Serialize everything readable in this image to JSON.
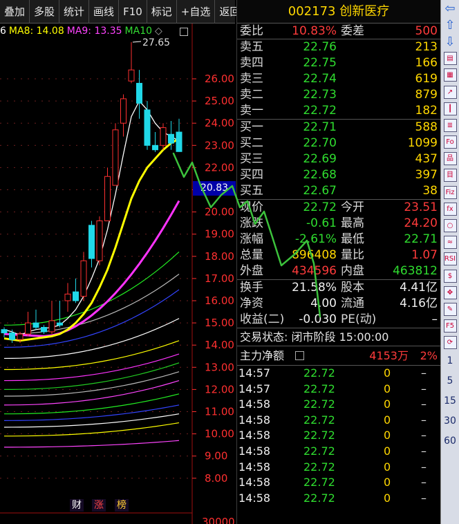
{
  "toolbar": {
    "buttons": [
      "叠加",
      "多股",
      "统计",
      "画线",
      "F10",
      "标记",
      "+自选",
      "返回"
    ]
  },
  "ma_legend": [
    {
      "label": "6",
      "color": "#ffffff"
    },
    {
      "label": "MA8: 14.08",
      "color": "#ffff00"
    },
    {
      "label": "MA9: 13.35",
      "color": "#ff44ff"
    },
    {
      "label": "MA10",
      "color": "#33dd33"
    }
  ],
  "legend_toggle_icon": "◇",
  "chart": {
    "price_labels": [
      "26.00",
      "25.00",
      "24.00",
      "23.00",
      "22.00",
      "21.00",
      "20.00",
      "19.00",
      "18.00",
      "17.00",
      "16.00",
      "15.00",
      "14.00",
      "13.00",
      "12.00",
      "11.00",
      "10.00",
      "9.00",
      "8.00"
    ],
    "price_values": [
      26,
      25,
      24,
      23,
      22,
      21,
      20,
      19,
      18,
      17,
      16,
      15,
      14,
      13,
      12,
      11,
      10,
      9,
      8
    ],
    "high_marker": "27.65",
    "current_price": "20.83",
    "bottom_axis_value": "30000",
    "badges": [
      "财",
      "涨",
      "榜"
    ],
    "candles": [
      {
        "o": 14.7,
        "c": 14.55,
        "h": 14.8,
        "l": 14.35
      },
      {
        "o": 14.55,
        "c": 14.25,
        "h": 14.7,
        "l": 14.1
      },
      {
        "o": 14.25,
        "c": 14.5,
        "h": 14.6,
        "l": 14.1
      },
      {
        "o": 14.5,
        "c": 15.0,
        "h": 15.5,
        "l": 14.4
      },
      {
        "o": 15.0,
        "c": 14.8,
        "h": 15.6,
        "l": 14.7
      },
      {
        "o": 14.8,
        "c": 14.6,
        "h": 14.9,
        "l": 14.5
      },
      {
        "o": 14.6,
        "c": 15.1,
        "h": 16.0,
        "l": 14.5
      },
      {
        "o": 15.0,
        "c": 14.9,
        "h": 16.0,
        "l": 14.8
      },
      {
        "o": 16.0,
        "c": 16.3,
        "h": 16.8,
        "l": 15.5
      },
      {
        "o": 16.4,
        "c": 16.0,
        "h": 17.0,
        "l": 15.9
      },
      {
        "o": 16.2,
        "c": 17.8,
        "h": 18.2,
        "l": 16.0
      },
      {
        "o": 19.4,
        "c": 17.9,
        "h": 19.6,
        "l": 17.5
      },
      {
        "o": 17.8,
        "c": 19.6,
        "h": 19.8,
        "l": 17.6
      },
      {
        "o": 19.6,
        "c": 21.6,
        "h": 22.0,
        "l": 19.6
      },
      {
        "o": 21.2,
        "c": 23.7,
        "h": 24.0,
        "l": 21.2
      },
      {
        "o": 24.0,
        "c": 25.1,
        "h": 25.3,
        "l": 23.4
      },
      {
        "o": 25.9,
        "c": 26.4,
        "h": 27.65,
        "l": 25.8
      },
      {
        "o": 25.8,
        "c": 24.9,
        "h": 26.4,
        "l": 24.2
      },
      {
        "o": 24.6,
        "c": 23.0,
        "h": 25.0,
        "l": 22.8
      },
      {
        "o": 23.0,
        "c": 22.8,
        "h": 23.6,
        "l": 22.7
      },
      {
        "o": 23.0,
        "c": 23.8,
        "h": 24.0,
        "l": 22.8
      },
      {
        "o": 23.5,
        "c": 23.1,
        "h": 24.1,
        "l": 22.8
      },
      {
        "o": 23.6,
        "c": 22.72,
        "h": 24.2,
        "l": 22.71
      }
    ],
    "ma_lines": [
      {
        "color": "#ffffff",
        "values": [
          14.7,
          14.6,
          14.45,
          14.6,
          14.7,
          14.75,
          14.8,
          14.9,
          15.2,
          15.6,
          16.2,
          17.0,
          17.9,
          19.2,
          20.8,
          22.6,
          24.3,
          25.0,
          24.6,
          24.0,
          23.6,
          23.4,
          23.2
        ]
      },
      {
        "color": "#ffff00",
        "values": [
          14.3,
          14.25,
          14.2,
          14.25,
          14.3,
          14.35,
          14.4,
          14.5,
          14.7,
          15.0,
          15.4,
          15.9,
          16.6,
          17.4,
          18.4,
          19.5,
          20.6,
          21.4,
          22.0,
          22.4,
          22.8,
          23.1,
          23.3
        ]
      }
    ]
  },
  "quote": {
    "title": "002173 创新医疗",
    "committee_ratio": {
      "label": "委比",
      "value": "10.83%",
      "diff_label": "委差",
      "diff_value": "500"
    },
    "asks": [
      {
        "label": "卖五",
        "price": "22.76",
        "vol": "213"
      },
      {
        "label": "卖四",
        "price": "22.75",
        "vol": "166"
      },
      {
        "label": "卖三",
        "price": "22.74",
        "vol": "619"
      },
      {
        "label": "卖二",
        "price": "22.73",
        "vol": "879"
      },
      {
        "label": "卖一",
        "price": "22.72",
        "vol": "182"
      }
    ],
    "bids": [
      {
        "label": "买一",
        "price": "22.71",
        "vol": "588"
      },
      {
        "label": "买二",
        "price": "22.70",
        "vol": "1099"
      },
      {
        "label": "买三",
        "price": "22.69",
        "vol": "437"
      },
      {
        "label": "买四",
        "price": "22.68",
        "vol": "397"
      },
      {
        "label": "买五",
        "price": "22.67",
        "vol": "38"
      }
    ],
    "stats": [
      {
        "l1": "现价",
        "v1": "22.72",
        "c1": "grn",
        "l2": "今开",
        "v2": "23.51",
        "c2": "red"
      },
      {
        "l1": "涨跌",
        "v1": "-0.61",
        "c1": "grn",
        "l2": "最高",
        "v2": "24.20",
        "c2": "red"
      },
      {
        "l1": "涨幅",
        "v1": "-2.61%",
        "c1": "grn",
        "l2": "最低",
        "v2": "22.71",
        "c2": "grn"
      },
      {
        "l1": "总量",
        "v1": "896408",
        "c1": "yel",
        "l2": "量比",
        "v2": "1.07",
        "c2": "red"
      },
      {
        "l1": "外盘",
        "v1": "434596",
        "c1": "red",
        "l2": "内盘",
        "v2": "463812",
        "c2": "grn"
      }
    ],
    "fundamentals": [
      {
        "l1": "换手",
        "v1": "21.58%",
        "l2": "股本",
        "v2": "4.41亿"
      },
      {
        "l1": "净资",
        "v1": "4.00",
        "l2": "流通",
        "v2": "4.16亿"
      },
      {
        "l1": "收益(二)",
        "v1": "-0.030",
        "l2": "PE(动)",
        "v2": "–"
      }
    ],
    "trade_status": "交易状态: 闭市阶段 15:00:00",
    "capital": {
      "label": "主力净额",
      "value": "4153万",
      "pct": "2%"
    },
    "ticks": [
      {
        "time": "14:57",
        "price": "22.72",
        "vol": "0",
        "dir": "–"
      },
      {
        "time": "14:57",
        "price": "22.72",
        "vol": "0",
        "dir": "–"
      },
      {
        "time": "14:58",
        "price": "22.72",
        "vol": "0",
        "dir": "–"
      },
      {
        "time": "14:58",
        "price": "22.72",
        "vol": "0",
        "dir": "–"
      },
      {
        "time": "14:58",
        "price": "22.72",
        "vol": "0",
        "dir": "–"
      },
      {
        "time": "14:58",
        "price": "22.72",
        "vol": "0",
        "dir": "–"
      },
      {
        "time": "14:58",
        "price": "22.72",
        "vol": "0",
        "dir": "–"
      },
      {
        "time": "14:58",
        "price": "22.72",
        "vol": "0",
        "dir": "–"
      },
      {
        "time": "14:58",
        "price": "22.72",
        "vol": "0",
        "dir": "–"
      }
    ]
  },
  "sidebar": {
    "icons": [
      "arrow-left-icon",
      "arrow-up-icon",
      "arrow-down-icon",
      "report-icon",
      "grid-icon",
      "line-chart-icon",
      "candlestick-icon",
      "list-icon",
      "f10-icon",
      "tree-icon",
      "calendar-icon",
      "fiz-icon",
      "formula-icon",
      "circle-icon",
      "wave-icon",
      "rsi-icon",
      "money-icon",
      "move-icon",
      "pencil-icon",
      "f5-icon",
      "refresh-icon"
    ],
    "icon_glyphs": [
      "⇦",
      "⇧",
      "⇩",
      "▤",
      "▦",
      "↗",
      "┃",
      "≣",
      "Fo",
      "品",
      "目",
      "Fiz",
      "fx",
      "○",
      "≈",
      "RSI",
      "$",
      "✥",
      "✎",
      "F5",
      "⟳"
    ],
    "periods": [
      "1",
      "5",
      "15",
      "30",
      "60"
    ]
  }
}
